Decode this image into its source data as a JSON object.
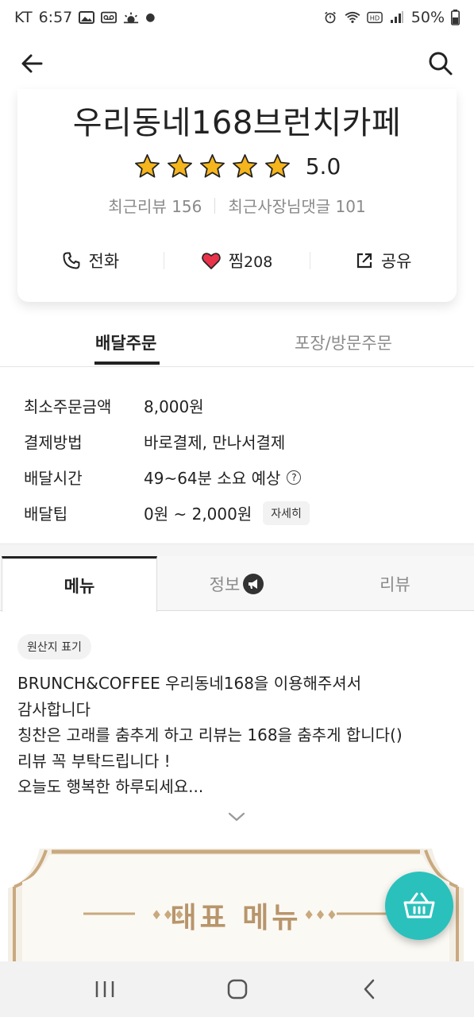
{
  "status_bar": {
    "carrier": "KT",
    "time": "6:57",
    "battery": "50%",
    "left_icons": [
      "gallery-icon",
      "voicemail-icon",
      "weather-icon",
      "dot-icon"
    ],
    "right_icons": [
      "alarm-icon",
      "wifi-icon",
      "hd-icon",
      "signal-icon",
      "battery-icon"
    ]
  },
  "app_bar": {
    "back_icon": "arrow-left-icon",
    "search_icon": "search-icon"
  },
  "store": {
    "name": "우리동네168브런치카페",
    "stars": 5,
    "rating": "5.0",
    "recent_reviews": "최근리뷰 156",
    "recent_owner_replies": "최근사장님댓글 101",
    "actions": {
      "call": "전화",
      "like": "찜",
      "like_count": "208",
      "share": "공유"
    }
  },
  "order_tabs": {
    "delivery": "배달주문",
    "pickup": "포장/방문주문"
  },
  "info": {
    "min_order_label": "최소주문금액",
    "min_order_value": "8,000원",
    "payment_label": "결제방법",
    "payment_value": "바로결제, 만나서결제",
    "delivery_time_label": "배달시간",
    "delivery_time_value": "49~64분 소요 예상",
    "delivery_tip_label": "배달팁",
    "delivery_tip_value": "0원 ~ 2,000원",
    "detail_button": "자세히"
  },
  "menu_tabs": {
    "menu": "메뉴",
    "info": "정보",
    "review": "리뷰"
  },
  "origin_label": "원산지 표기",
  "notice_lines": [
    "BRUNCH&COFFEE 우리동네168을 이용해주셔서",
    "감사합니다",
    "칭찬은 고래를 춤추게 하고 리뷰는 168을 춤추게 합니다()",
    "리뷰 꼭 부탁드립니다 !",
    "오늘도 행복한 하루되세요..."
  ],
  "banner": {
    "title": "대표 메뉴"
  },
  "colors": {
    "accent": "#2ac1bc",
    "star": "#f5b51c",
    "heart": "#e8334a",
    "banner_gold": "#b8956b"
  }
}
